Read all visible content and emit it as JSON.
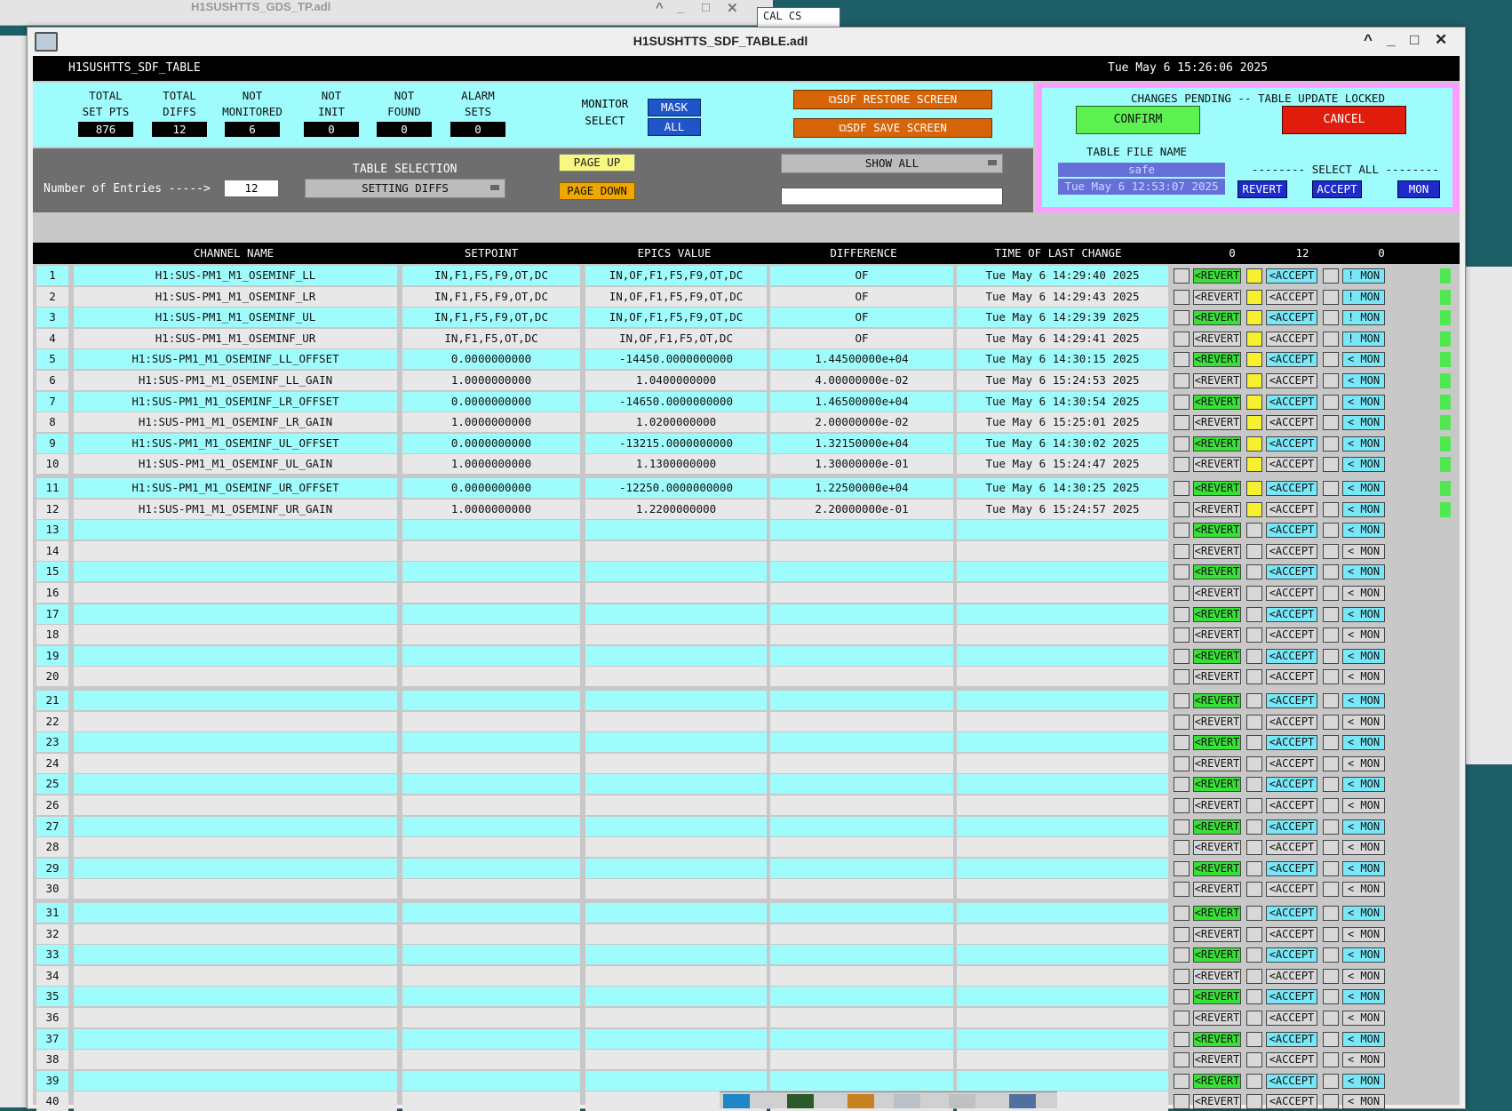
{
  "background_windows": {
    "top_title": "H1SUSHTTS_GDS_TP.adl",
    "cal_cs_label": "CAL CS"
  },
  "window": {
    "title": "H1SUSHTTS_SDF_TABLE.adl",
    "header_name": "H1SUSHTTS_SDF_TABLE",
    "header_time": "Tue May  6 15:26:06 2025"
  },
  "stats": [
    {
      "label1": "TOTAL",
      "label2": "SET PTS",
      "value": "876"
    },
    {
      "label1": "TOTAL",
      "label2": "DIFFS",
      "value": "12"
    },
    {
      "label1": "NOT",
      "label2": "MONITORED",
      "value": "6"
    },
    {
      "label1": "NOT",
      "label2": "INIT",
      "value": "0"
    },
    {
      "label1": "NOT",
      "label2": "FOUND",
      "value": "0"
    },
    {
      "label1": "ALARM",
      "label2": "SETS",
      "value": "0"
    }
  ],
  "monitor": {
    "label1": "MONITOR",
    "label2": "SELECT",
    "mask": "MASK",
    "all": "ALL"
  },
  "sdf": {
    "restore": "SDF RESTORE SCREEN",
    "save": "SDF SAVE SCREEN"
  },
  "selection": {
    "title": "TABLE SELECTION",
    "entries_label": "Number of Entries ----->",
    "entries_value": "12",
    "setting": "SETTING DIFFS",
    "page_up": "PAGE UP",
    "page_down": "PAGE DOWN",
    "show_all": "SHOW ALL"
  },
  "pending": {
    "title": "CHANGES PENDING -- TABLE UPDATE LOCKED",
    "confirm": "CONFIRM",
    "cancel": "CANCEL",
    "file_label": "TABLE FILE NAME",
    "file_name": "safe",
    "file_date": "Tue May  6 12:53:07 2025",
    "select_all": "-------- SELECT ALL --------",
    "revert": "REVERT",
    "accept": "ACCEPT",
    "mon": "MON"
  },
  "table": {
    "headers": {
      "channel": "CHANNEL NAME",
      "setpoint": "SETPOINT",
      "epics": "EPICS VALUE",
      "difference": "DIFFERENCE",
      "time": "TIME OF LAST CHANGE",
      "count_revert": "0",
      "count_accept": "12",
      "count_mon": "0"
    },
    "button_labels": {
      "revert": "<REVERT",
      "accept": "<ACCEPT",
      "mon_bang": "! MON",
      "mon": "< MON"
    },
    "rows": [
      {
        "n": "1",
        "channel": "H1:SUS-PM1_M1_OSEMINF_LL",
        "setpoint": "IN,F1,F5,F9,OT,DC",
        "epics": "IN,OF,F1,F5,F9,OT,DC",
        "diff": "OF",
        "time": "Tue May  6 14:29:40 2025",
        "mon": "! MON",
        "yellow": true
      },
      {
        "n": "2",
        "channel": "H1:SUS-PM1_M1_OSEMINF_LR",
        "setpoint": "IN,F1,F5,F9,OT,DC",
        "epics": "IN,OF,F1,F5,F9,OT,DC",
        "diff": "OF",
        "time": "Tue May  6 14:29:43 2025",
        "mon": "! MON",
        "yellow": true
      },
      {
        "n": "3",
        "channel": "H1:SUS-PM1_M1_OSEMINF_UL",
        "setpoint": "IN,F1,F5,F9,OT,DC",
        "epics": "IN,OF,F1,F5,F9,OT,DC",
        "diff": "OF",
        "time": "Tue May  6 14:29:39 2025",
        "mon": "! MON",
        "yellow": true
      },
      {
        "n": "4",
        "channel": "H1:SUS-PM1_M1_OSEMINF_UR",
        "setpoint": "IN,F1,F5,OT,DC",
        "epics": "IN,OF,F1,F5,OT,DC",
        "diff": "OF",
        "time": "Tue May  6 14:29:41 2025",
        "mon": "! MON",
        "yellow": true
      },
      {
        "n": "5",
        "channel": "H1:SUS-PM1_M1_OSEMINF_LL_OFFSET",
        "setpoint": "0.0000000000",
        "epics": "-14450.0000000000",
        "diff": "1.44500000e+04",
        "time": "Tue May  6 14:30:15 2025",
        "mon": "< MON",
        "yellow": true
      },
      {
        "n": "6",
        "channel": "H1:SUS-PM1_M1_OSEMINF_LL_GAIN",
        "setpoint": "1.0000000000",
        "epics": "1.0400000000",
        "diff": "4.00000000e-02",
        "time": "Tue May  6 15:24:53 2025",
        "mon": "< MON",
        "yellow": true
      },
      {
        "n": "7",
        "channel": "H1:SUS-PM1_M1_OSEMINF_LR_OFFSET",
        "setpoint": "0.0000000000",
        "epics": "-14650.0000000000",
        "diff": "1.46500000e+04",
        "time": "Tue May  6 14:30:54 2025",
        "mon": "< MON",
        "yellow": true
      },
      {
        "n": "8",
        "channel": "H1:SUS-PM1_M1_OSEMINF_LR_GAIN",
        "setpoint": "1.0000000000",
        "epics": "1.0200000000",
        "diff": "2.00000000e-02",
        "time": "Tue May  6 15:25:01 2025",
        "mon": "< MON",
        "yellow": true
      },
      {
        "n": "9",
        "channel": "H1:SUS-PM1_M1_OSEMINF_UL_OFFSET",
        "setpoint": "0.0000000000",
        "epics": "-13215.0000000000",
        "diff": "1.32150000e+04",
        "time": "Tue May  6 14:30:02 2025",
        "mon": "< MON",
        "yellow": true
      },
      {
        "n": "10",
        "channel": "H1:SUS-PM1_M1_OSEMINF_UL_GAIN",
        "setpoint": "1.0000000000",
        "epics": "1.1300000000",
        "diff": "1.30000000e-01",
        "time": "Tue May  6 15:24:47 2025",
        "mon": "< MON",
        "yellow": true
      },
      {
        "n": "11",
        "channel": "H1:SUS-PM1_M1_OSEMINF_UR_OFFSET",
        "setpoint": "0.0000000000",
        "epics": "-12250.0000000000",
        "diff": "1.22500000e+04",
        "time": "Tue May  6 14:30:25 2025",
        "mon": "< MON",
        "yellow": true
      },
      {
        "n": "12",
        "channel": "H1:SUS-PM1_M1_OSEMINF_UR_GAIN",
        "setpoint": "1.0000000000",
        "epics": "1.2200000000",
        "diff": "2.20000000e-01",
        "time": "Tue May  6 15:24:57 2025",
        "mon": "< MON",
        "yellow": true
      },
      {
        "n": "13"
      },
      {
        "n": "14"
      },
      {
        "n": "15"
      },
      {
        "n": "16"
      },
      {
        "n": "17"
      },
      {
        "n": "18"
      },
      {
        "n": "19"
      },
      {
        "n": "20"
      },
      {
        "n": "21"
      },
      {
        "n": "22"
      },
      {
        "n": "23"
      },
      {
        "n": "24"
      },
      {
        "n": "25"
      },
      {
        "n": "26"
      },
      {
        "n": "27"
      },
      {
        "n": "28"
      },
      {
        "n": "29"
      },
      {
        "n": "30"
      },
      {
        "n": "31"
      },
      {
        "n": "32"
      },
      {
        "n": "33"
      },
      {
        "n": "34"
      },
      {
        "n": "35"
      },
      {
        "n": "36"
      },
      {
        "n": "37"
      },
      {
        "n": "38"
      },
      {
        "n": "39"
      },
      {
        "n": "40"
      }
    ]
  },
  "colors": {
    "cyan": "#9ffcfc",
    "pink": "#ff9cff",
    "confirm": "#5cf050",
    "cancel": "#e01c0c",
    "orange": "#d86408"
  }
}
